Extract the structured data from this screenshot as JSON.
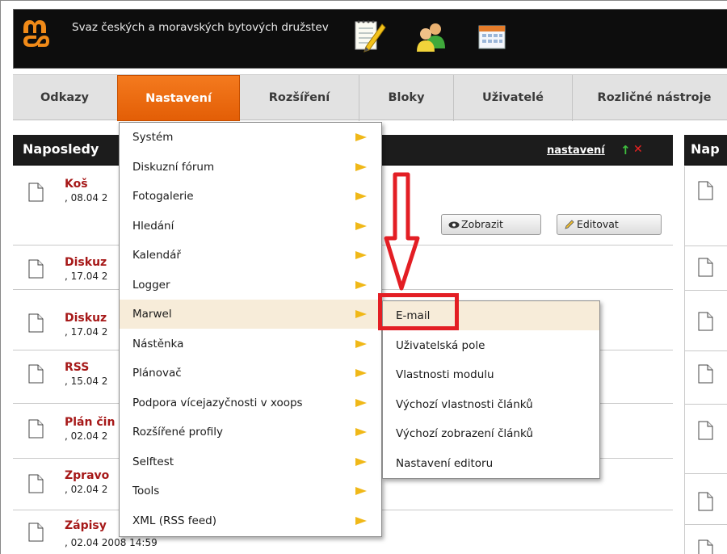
{
  "header": {
    "site_title": "Svaz českých a moravských bytových družstev",
    "icons": [
      "logo-icon",
      "notepad-icon",
      "users-icon",
      "calendar-icon"
    ]
  },
  "nav": {
    "items": [
      "Odkazy",
      "Nastavení",
      "Rozšíření",
      "Bloky",
      "Uživatelé",
      "Rozličné nástroje"
    ],
    "active": "Nastavení"
  },
  "left_panel": {
    "title": "Naposledy",
    "settings_link": "nastavení",
    "up_icon": "↑",
    "close_icon": "✕",
    "items": [
      {
        "title": "Koš",
        "date": ", 08.04 2"
      },
      {
        "title": "Diskuz",
        "date": ", 17.04 2"
      },
      {
        "title": "Diskuz",
        "date": ", 17.04 2"
      },
      {
        "title": "RSS",
        "date": ", 15.04 2"
      },
      {
        "title": "Plán čin",
        "date": ", 02.04 2"
      },
      {
        "title": "Zpravo",
        "date": ", 02.04 2"
      },
      {
        "title": "Zápisy",
        "date": ", 02.04 2008 14:59"
      }
    ],
    "view_button": "Zobrazit",
    "edit_button": "Editovat"
  },
  "right_panel": {
    "title": "Nap"
  },
  "menu": {
    "items": [
      "Systém",
      "Diskuzní fórum",
      "Fotogalerie",
      "Hledání",
      "Kalendář",
      "Logger",
      "Marwel",
      "Nástěnka",
      "Plánovač",
      "Podpora vícejazyčnosti v xoops",
      "Rozšířené profily",
      "Selftest",
      "Tools",
      "XML (RSS feed)"
    ],
    "highlighted": "Marwel"
  },
  "submenu": {
    "items": [
      "E-mail",
      "Uživatelská pole",
      "Vlastnosti modulu",
      "Výchozí vlastnosti článků",
      "Výchozí zobrazení článků",
      "Nastavení editoru"
    ],
    "highlighted": "E-mail"
  },
  "annotation_color": "#e31e24",
  "accent_color": "#ee6b12"
}
